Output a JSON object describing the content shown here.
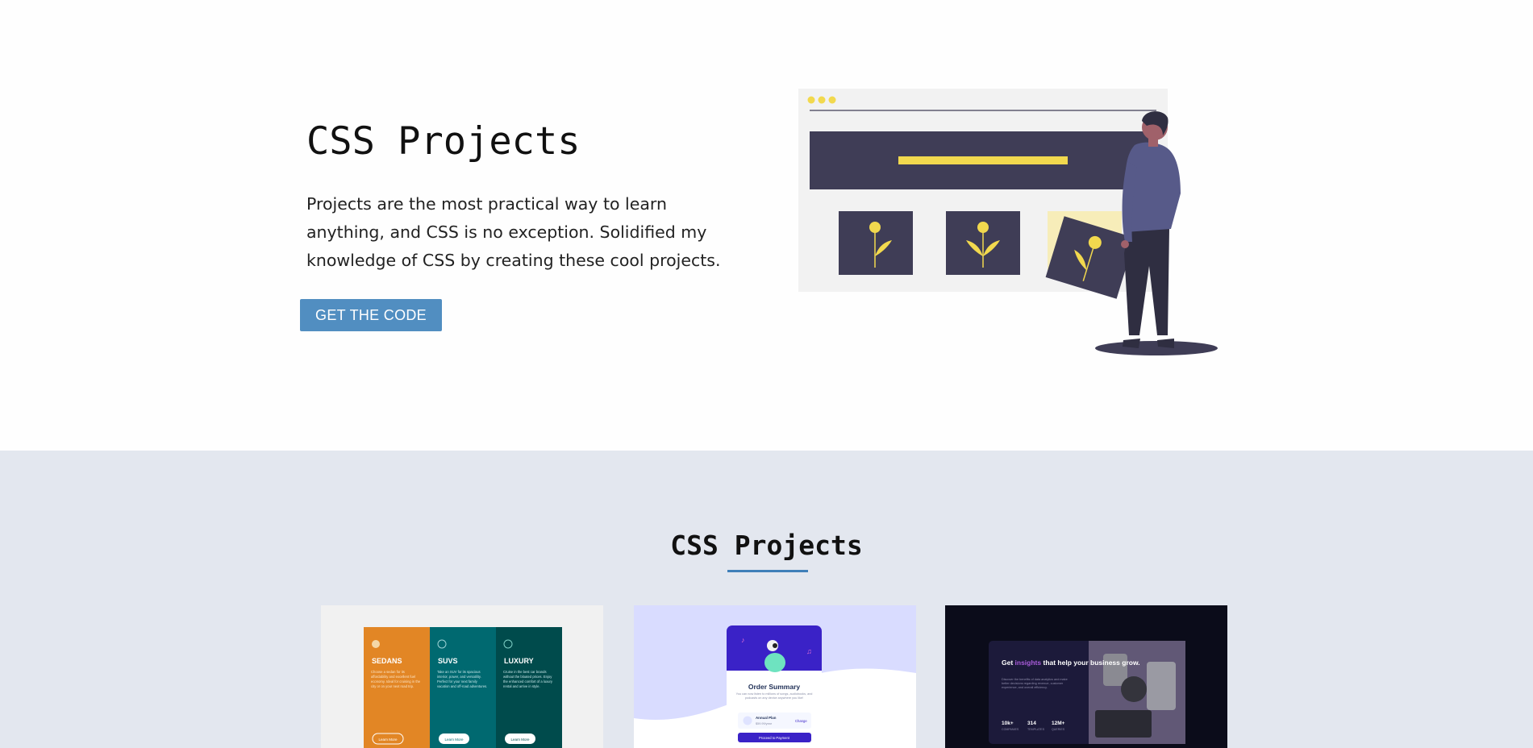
{
  "hero": {
    "title": "CSS Projects",
    "description": "Projects are the most practical way to learn anything, and CSS is no exception. Solidified my knowledge of CSS by creating these cool projects.",
    "button_label": "GET THE CODE"
  },
  "projects": {
    "title": "CSS Projects",
    "cards": [
      {
        "columns": [
          {
            "name": "SEDANS",
            "text": "Choose a sedan for its affordability and excellent fuel economy. Ideal for cruising in the city or on your next road trip.",
            "button": "Learn More"
          },
          {
            "name": "SUVS",
            "text": "Take an SUV for its spacious interior, power, and versatility. Perfect for your next family vacation and off-road adventures.",
            "button": "Learn More"
          },
          {
            "name": "LUXURY",
            "text": "Cruise in the best car brands without the bloated prices. Enjoy the enhanced comfort of a luxury rental and arrive in style.",
            "button": "Learn More"
          }
        ]
      },
      {
        "heading": "Order Summary",
        "text": "You can now listen to millions of songs, audiobooks, and podcasts on any device anywhere you like!",
        "plan_name": "Annual Plan",
        "plan_price": "$59.99/year",
        "change_link": "Change",
        "button": "Proceed to Payment"
      },
      {
        "heading_pre": "Get ",
        "heading_accent": "insights",
        "heading_post": " that help your business grow.",
        "text": "Discover the benefits of data analytics and make better decisions regarding revenue, customer experience, and overall efficiency.",
        "stats": [
          {
            "value": "10k+",
            "label": "COMPANIES"
          },
          {
            "value": "314",
            "label": "TEMPLATES"
          },
          {
            "value": "12M+",
            "label": "QUERIES"
          }
        ]
      }
    ]
  },
  "colors": {
    "button": "#518ec1",
    "underline": "#3f7fb9",
    "projects_bg": "#e3e7ef",
    "illustration_dark": "#3f3d56",
    "illustration_yellow": "#f2d94e",
    "person_shirt": "#575a89"
  }
}
